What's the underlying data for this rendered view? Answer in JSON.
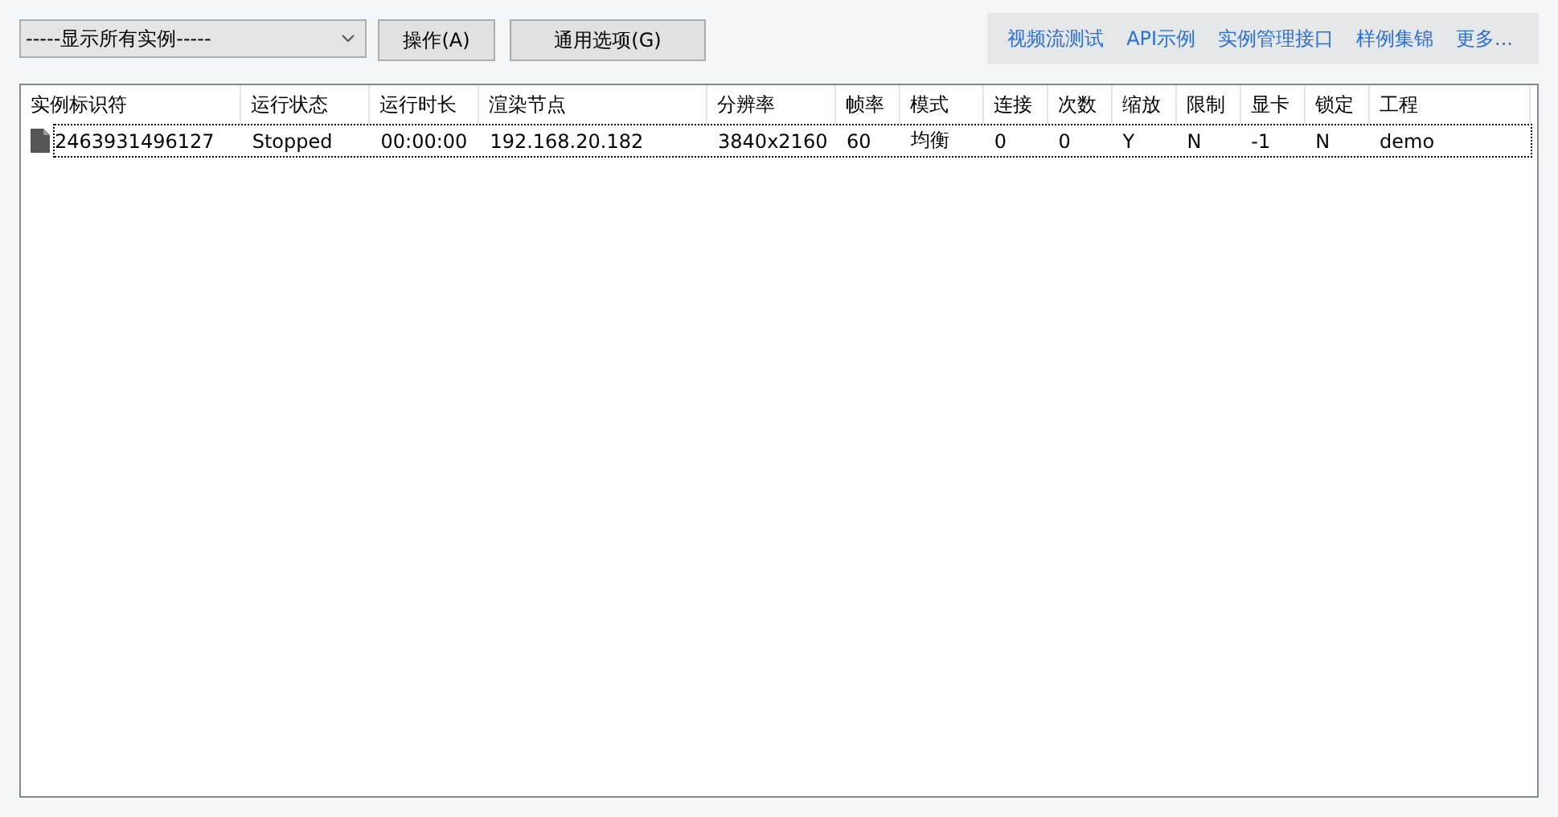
{
  "toolbar": {
    "filter": {
      "value": "-----显示所有实例-----"
    },
    "buttons": [
      "操作(A)",
      "通用选项(G)"
    ]
  },
  "links": [
    "视频流测试",
    "API示例",
    "实例管理接口",
    "样例集锦",
    "更多..."
  ],
  "table": {
    "columns": [
      "实例标识符",
      "运行状态",
      "运行时长",
      "渲染节点",
      "分辨率",
      "帧率",
      "模式",
      "连接",
      "次数",
      "缩放",
      "限制",
      "显卡",
      "锁定",
      "工程"
    ],
    "rows": [
      {
        "focused": true,
        "cells": [
          "2463931496127",
          "Stopped",
          "00:00:00",
          "192.168.20.182",
          "3840x2160",
          "60",
          "均衡",
          "0",
          "0",
          "Y",
          "N",
          "-1",
          "N",
          "demo"
        ]
      }
    ]
  }
}
